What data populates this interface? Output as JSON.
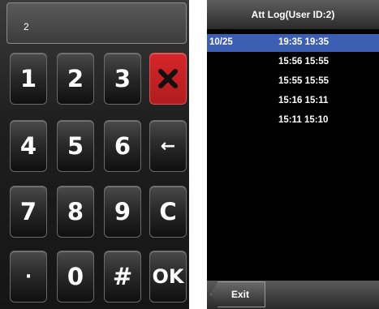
{
  "keypad": {
    "display_value": "2",
    "keys": {
      "k1": "1",
      "k2": "2",
      "k3": "3",
      "k4": "4",
      "k5": "5",
      "k6": "6",
      "k7": "7",
      "k8": "8",
      "k9": "9",
      "dot": "·",
      "k0": "0",
      "hash": "#",
      "back": "←",
      "clear": "C",
      "ok": "OK"
    },
    "delete_icon": "x-icon",
    "delete_color": "#c8201f"
  },
  "att_log": {
    "title": "Att Log(User ID:2)",
    "rows": [
      {
        "date": "10/25",
        "times": "19:35 19:35"
      },
      {
        "date": "",
        "times": "15:56 15:55"
      },
      {
        "date": "",
        "times": "15:55 15:55"
      },
      {
        "date": "",
        "times": "15:16 15:11"
      },
      {
        "date": "",
        "times": "15:11 15:10"
      }
    ],
    "selected_row_color": "#3c5fb4",
    "exit_label": "Exit"
  }
}
